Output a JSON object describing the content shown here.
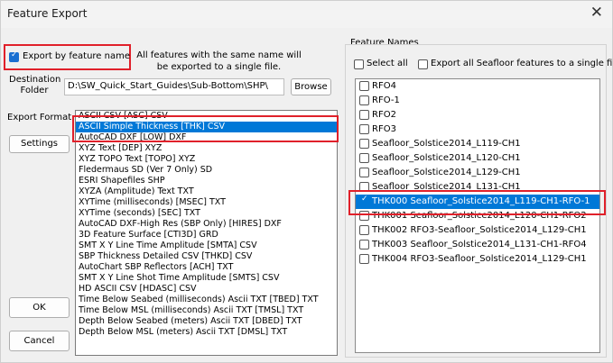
{
  "window": {
    "title": "Feature Export",
    "close_glyph": "✕"
  },
  "export_by_name": {
    "label": "Export by feature name",
    "checked": true
  },
  "note": "All features with the same name will be exported to a single file.",
  "destination": {
    "label": "Destination Folder",
    "value": "D:\\SW_Quick_Start_Guides\\Sub-Bottom\\SHP\\",
    "browse": "Browse"
  },
  "export_format": {
    "label": "Export Format",
    "settings": "Settings",
    "items": [
      "ASCII CSV [ASC] CSV",
      "ASCII Simple Thickness [THK] CSV",
      "AutoCAD DXF [LOW] DXF",
      "XYZ Text [DEP] XYZ",
      "XYZ TOPO Text [TOPO] XYZ",
      "Fledermaus SD (Ver 7 Only) SD",
      "ESRI Shapefiles SHP",
      "XYZA (Amplitude) Text TXT",
      "XYTime (milliseconds) [MSEC] TXT",
      "XYTime (seconds) [SEC] TXT",
      "AutoCAD DXF-High Res (SBP Only) [HIRES] DXF",
      "3D Feature Surface [CTI3D] GRD",
      "SMT X Y Line Time Amplitude [SMTA] CSV",
      "SBP Thickness Detailed CSV [THKD] CSV",
      "AutoChart SBP Reflectors [ACH] TXT",
      "SMT X Y Line Shot Time Amplitude [SMTS] CSV",
      "HD ASCII CSV [HDASC] CSV",
      "Time Below Seabed (milliseconds) Ascii TXT [TBED] TXT",
      "Time Below MSL (milliseconds) Ascii TXT [TMSL] TXT",
      "Depth Below Seabed (meters) Ascii TXT [DBED] TXT",
      "Depth Below MSL (meters) Ascii TXT [DMSL] TXT"
    ],
    "selected_index": 1
  },
  "buttons": {
    "ok": "OK",
    "cancel": "Cancel"
  },
  "feature_names": {
    "group_label": "Feature Names",
    "select_all": "Select all",
    "export_all": "Export all Seafloor features to a single file",
    "items": [
      "RFO4",
      "RFO-1",
      "RFO2",
      "RFO3",
      "Seafloor_Solstice2014_L119-CH1",
      "Seafloor_Solstice2014_L120-CH1",
      "Seafloor_Solstice2014_L129-CH1",
      "Seafloor_Solstice2014_L131-CH1",
      "THK000 Seafloor_Solstice2014_L119-CH1-RFO-1",
      "THK001 Seafloor_Solstice2014_L120-CH1-RFO2",
      "THK002 RFO3-Seafloor_Solstice2014_L129-CH1",
      "THK003 Seafloor_Solstice2014_L131-CH1-RFO4",
      "THK004 RFO3-Seafloor_Solstice2014_L129-CH1"
    ],
    "selected_index": 8
  },
  "colors": {
    "highlight_box": "#e0202a",
    "selection": "#0078d7"
  }
}
